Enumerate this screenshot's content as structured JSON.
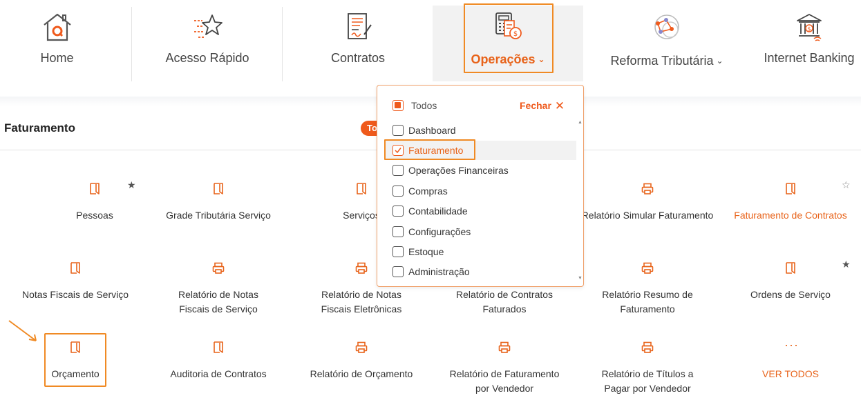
{
  "nav": {
    "items": [
      {
        "label": "Home",
        "icon": "home-icon"
      },
      {
        "label": "Acesso Rápido",
        "icon": "star-speed-icon"
      },
      {
        "label": "Contratos",
        "icon": "contract-icon"
      },
      {
        "label": "Operações",
        "icon": "calculator-money-icon",
        "active": true
      },
      {
        "label": "Reforma Tributária",
        "icon": "network-icon"
      },
      {
        "label": "Internet Banking",
        "icon": "bank-icon"
      }
    ]
  },
  "section": {
    "title": "Faturamento",
    "pill": "Todos"
  },
  "grid": {
    "tiles": [
      {
        "label": "Pessoas",
        "icon": "document-icon",
        "starred": true
      },
      {
        "label": "Grade Tributária Serviço",
        "icon": "document-icon"
      },
      {
        "label": "Serviços",
        "icon": "document-icon"
      },
      {
        "label": "Relatório Simular Faturamento",
        "icon": "printer-icon"
      },
      {
        "label": "Faturamento de Contratos",
        "icon": "document-icon",
        "starred": false
      },
      {
        "label": "Notas Fiscais de Serviço",
        "icon": "document-icon"
      },
      {
        "label": "Relatório de Notas Fiscais de Serviço",
        "icon": "printer-icon"
      },
      {
        "label": "Relatório de Notas Fiscais Eletrônicas",
        "icon": "printer-icon"
      },
      {
        "label": "Relatório de Contratos Faturados",
        "icon": "printer-icon"
      },
      {
        "label": "Relatório Resumo de Faturamento",
        "icon": "printer-icon"
      },
      {
        "label": "Ordens de Serviço",
        "icon": "document-icon",
        "starred": true
      },
      {
        "label": "Orçamento",
        "icon": "document-icon"
      },
      {
        "label": "Auditoria de Contratos",
        "icon": "document-icon"
      },
      {
        "label": "Relatório de Orçamento",
        "icon": "printer-icon"
      },
      {
        "label": "Relatório de Faturamento por Vendedor",
        "icon": "printer-icon"
      },
      {
        "label": "Relatório de Títulos a Pagar por Vendedor",
        "icon": "printer-icon"
      },
      {
        "label": "VER TODOS",
        "icon": "more-dots-icon"
      }
    ],
    "dots": "···"
  },
  "dropdown": {
    "all_label": "Todos",
    "close_label": "Fechar",
    "items": [
      {
        "label": "Dashboard",
        "checked": false
      },
      {
        "label": "Faturamento",
        "checked": true
      },
      {
        "label": "Operações Financeiras",
        "checked": false
      },
      {
        "label": "Compras",
        "checked": false
      },
      {
        "label": "Contabilidade",
        "checked": false
      },
      {
        "label": "Configurações",
        "checked": false
      },
      {
        "label": "Estoque",
        "checked": false
      },
      {
        "label": "Administração",
        "checked": false
      }
    ]
  },
  "colors": {
    "accent": "#ef5a1c",
    "highlight_border": "#f08a24",
    "icon_orange": "#e8631a"
  }
}
